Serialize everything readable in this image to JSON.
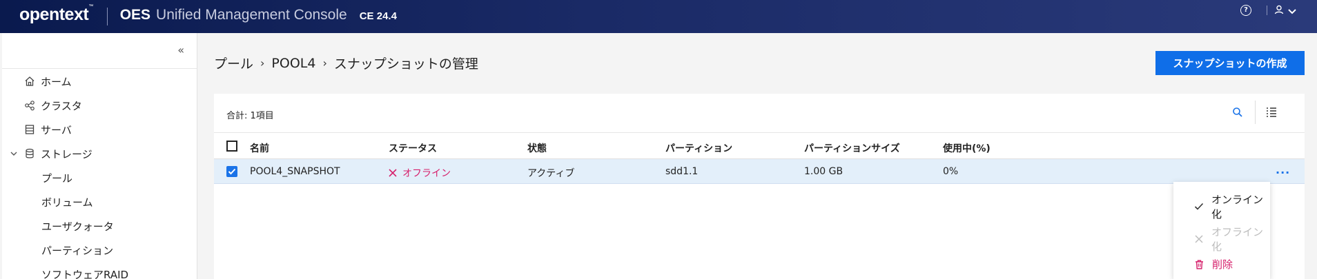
{
  "header": {
    "brand": "opentext",
    "brand_tm": "™",
    "app_bold": "OES",
    "app_name": "Unified Management Console",
    "version": "CE 24.4",
    "icons": [
      "help-icon",
      "user-icon",
      "chevron-down-icon"
    ]
  },
  "sidebar": {
    "collapse_label": "«",
    "items": [
      {
        "label": "ホーム",
        "icon": "home-icon"
      },
      {
        "label": "クラスタ",
        "icon": "cluster-icon"
      },
      {
        "label": "サーバ",
        "icon": "server-icon"
      },
      {
        "label": "ストレージ",
        "icon": "storage-icon",
        "expanded": true
      },
      {
        "label": "プール"
      },
      {
        "label": "ボリューム"
      },
      {
        "label": "ユーザクォータ"
      },
      {
        "label": "パーティション"
      },
      {
        "label": "ソフトウェアRAID"
      }
    ]
  },
  "breadcrumb": {
    "items": [
      "プール",
      "POOL4",
      "スナップショットの管理"
    ],
    "separator": "›"
  },
  "create_button": "スナップショットの作成",
  "table": {
    "total": "合計: 1項目",
    "columns": [
      "名前",
      "ステータス",
      "状態",
      "パーティション",
      "パーティションサイズ",
      "使用中(%)"
    ],
    "rows": [
      {
        "selected": true,
        "name": "POOL4_SNAPSHOT",
        "status": "オフライン",
        "state": "アクティブ",
        "partition": "sdd1.1",
        "partition_size": "1.00 GB",
        "in_use": "0%"
      }
    ],
    "row_menu": "···"
  },
  "row_actions": {
    "online": "オンライン化",
    "offline": "オフライン化",
    "delete": "削除"
  },
  "colors": {
    "header_bg": "#1a2a66",
    "accent": "#0f6ee8",
    "offline": "#d6206b",
    "selected_row": "#e3effa"
  }
}
